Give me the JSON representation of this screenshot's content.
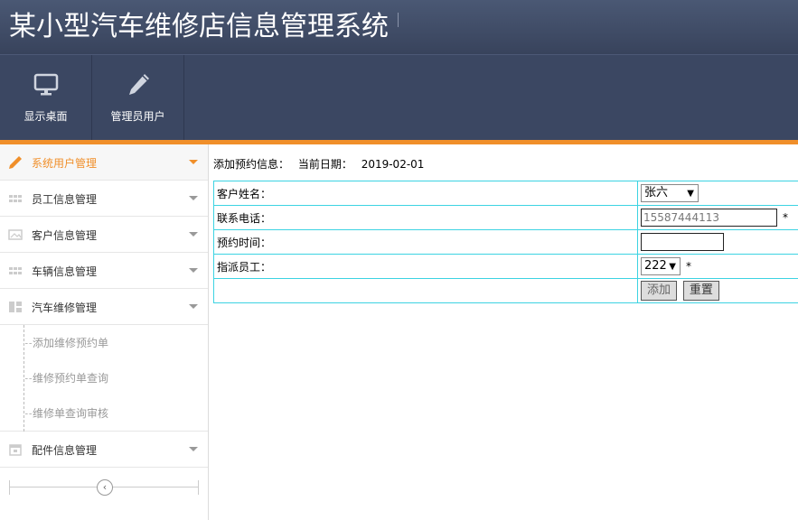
{
  "app": {
    "title": "某小型汽车维修店信息管理系统"
  },
  "toolbar": [
    {
      "label": "显示桌面",
      "icon": "monitor-icon"
    },
    {
      "label": "管理员用户",
      "icon": "pencil-icon"
    }
  ],
  "sidebar": {
    "menus": [
      {
        "label": "系统用户管理",
        "icon": "pencil-icon",
        "active": true
      },
      {
        "label": "员工信息管理",
        "icon": "grid-icon"
      },
      {
        "label": "客户信息管理",
        "icon": "image-icon"
      },
      {
        "label": "车辆信息管理",
        "icon": "grid-icon"
      },
      {
        "label": "汽车维修管理",
        "icon": "layout-icon"
      },
      {
        "label": "配件信息管理",
        "icon": "calendar-icon"
      }
    ],
    "submenu": [
      {
        "label": "添加维修预约单"
      },
      {
        "label": "维修预约单查询"
      },
      {
        "label": "维修单查询审核"
      }
    ],
    "collapse_icon": "‹"
  },
  "content": {
    "heading_label": "添加预约信息：",
    "date_label": "当前日期：",
    "date_value": "2019-02-01"
  },
  "form": {
    "customer_label": "客户姓名：",
    "customer_value": "张六",
    "phone_label": "联系电话：",
    "phone_value": "15587444113",
    "phone_required": "*",
    "time_label": "预约时间：",
    "time_value": "",
    "employee_label": "指派员工：",
    "employee_value": "222",
    "employee_required": "*",
    "add_button": "添加",
    "reset_button": "重置"
  },
  "colors": {
    "header": "#3f4b66",
    "accent": "#f08f2a",
    "table_border": "#3cd3e2"
  }
}
